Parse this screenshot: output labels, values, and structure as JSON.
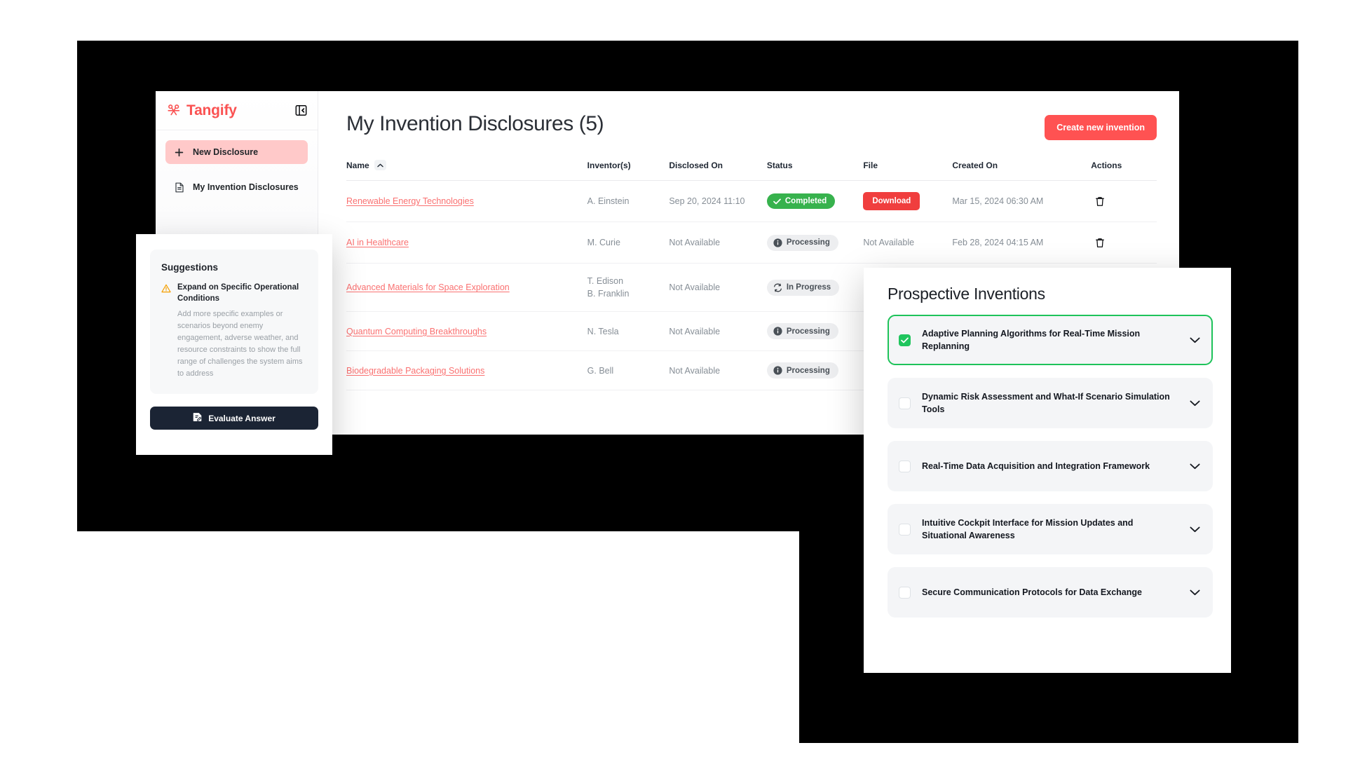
{
  "app": {
    "brand": "Tangify",
    "brand_color": "#fa5252",
    "collapse_icon": "panel-collapse-icon"
  },
  "sidebar": {
    "items": [
      {
        "label": "New Disclosure",
        "icon": "plus-icon",
        "active": true
      },
      {
        "label": "My Invention Disclosures",
        "icon": "document-icon",
        "active": false
      }
    ]
  },
  "main": {
    "page_title": "My Invention Disclosures (5)",
    "create_button": "Create new invention",
    "table": {
      "columns": [
        "Name",
        "Inventor(s)",
        "Disclosed On",
        "Status",
        "File",
        "Created On",
        "Actions"
      ],
      "sort_column": "Name",
      "sort_direction": "asc",
      "rows": [
        {
          "name": "Renewable Energy Technologies",
          "inventors": [
            "A. Einstein"
          ],
          "disclosed_on": "Sep 20, 2024 11:10",
          "status": "Completed",
          "status_kind": "completed",
          "file": "Download",
          "file_kind": "download",
          "created_on": "Mar 15, 2024 06:30 AM",
          "action": "delete-icon"
        },
        {
          "name": "AI in Healthcare",
          "inventors": [
            "M. Curie"
          ],
          "disclosed_on": "Not Available",
          "status": "Processing",
          "status_kind": "processing",
          "file": "Not Available",
          "file_kind": "text",
          "created_on": "Feb 28, 2024 04:15 AM",
          "action": "delete-icon"
        },
        {
          "name": "Advanced Materials for Space Exploration",
          "inventors": [
            "T. Edison",
            "B. Franklin"
          ],
          "disclosed_on": "Not Available",
          "status": "In Progress",
          "status_kind": "inprogress",
          "file": "",
          "file_kind": "text",
          "created_on": "",
          "action": ""
        },
        {
          "name": "Quantum Computing Breakthroughs",
          "inventors": [
            "N. Tesla"
          ],
          "disclosed_on": "Not Available",
          "status": "Processing",
          "status_kind": "processing",
          "file": "",
          "file_kind": "text",
          "created_on": "",
          "action": ""
        },
        {
          "name": "Biodegradable Packaging Solutions",
          "inventors": [
            "G. Bell"
          ],
          "disclosed_on": "Not Available",
          "status": "Processing",
          "status_kind": "processing",
          "file": "",
          "file_kind": "text",
          "created_on": "",
          "action": ""
        }
      ]
    }
  },
  "suggestions": {
    "title": "Suggestions",
    "icon": "warning-icon",
    "heading": "Expand on Specific Operational Conditions",
    "body": "Add more specific examples or scenarios beyond enemy engagement, adverse weather, and resource constraints to show the full range of challenges the system aims to address",
    "evaluate_button": "Evaluate Answer"
  },
  "prospective": {
    "title": "Prospective Inventions",
    "items": [
      {
        "label": "Adaptive Planning Algorithms for Real-Time Mission Replanning",
        "checked": true
      },
      {
        "label": "Dynamic Risk Assessment and What-If Scenario Simulation Tools",
        "checked": false
      },
      {
        "label": "Real-Time Data Acquisition and Integration Framework",
        "checked": false
      },
      {
        "label": "Intuitive Cockpit Interface for Mission Updates and Situational Awareness",
        "checked": false
      },
      {
        "label": "Secure Communication Protocols for Data Exchange",
        "checked": false
      }
    ]
  },
  "colors": {
    "brand_red": "#fa5252",
    "accent_red": "#ff5252",
    "download_red": "#f03e3e",
    "success_green": "#37b24d",
    "selected_green": "#1ec35a",
    "dark_button": "#1b2434"
  }
}
